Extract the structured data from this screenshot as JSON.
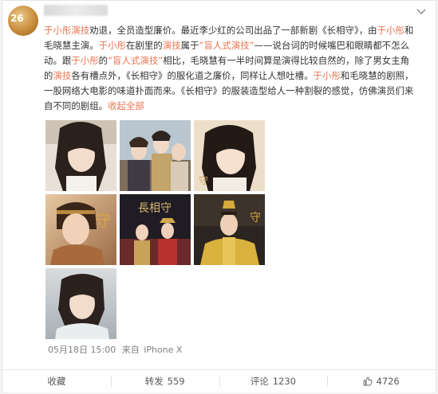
{
  "post": {
    "segments": [
      {
        "text": "于小彤演技",
        "link": true
      },
      {
        "text": "劝退，全员造型廉价。最近李少红的公司出品了一部新剧《长相守》，由",
        "link": false
      },
      {
        "text": "于小彤",
        "link": true
      },
      {
        "text": "和毛晓慧主演。",
        "link": false
      },
      {
        "text": "于小彤",
        "link": true
      },
      {
        "text": "在剧里的",
        "link": false
      },
      {
        "text": "演技",
        "link": true
      },
      {
        "text": "属于",
        "link": false
      },
      {
        "text": "“盲人式演技”",
        "link": true
      },
      {
        "text": "——说台词的时候嘴巴和眼睛都不怎么动。跟",
        "link": false
      },
      {
        "text": "于小彤",
        "link": true
      },
      {
        "text": "的",
        "link": false
      },
      {
        "text": "“盲人式演技”",
        "link": true
      },
      {
        "text": "相比，毛晓慧有一半时间算是演得比较自然的，除了男女主角的",
        "link": false
      },
      {
        "text": "演技",
        "link": true
      },
      {
        "text": "各有槽点外，《长相守》的服化道之廉价，同样让人想吐槽。",
        "link": false
      },
      {
        "text": "于小彤",
        "link": true
      },
      {
        "text": "和毛晓慧的剧照，一股网络大电影的味道扑面而来。《长相守》的服装造型给人一种割裂的感觉，仿佛演员们来自不同的剧组。",
        "link": false
      }
    ],
    "more_label": "收起全部",
    "time": "05月18日 15:00",
    "source_prefix": "来自",
    "source": "iPhone X"
  },
  "actions": {
    "favorite_label": "收藏",
    "repost_label": "转发",
    "repost_count": "559",
    "comment_label": "评论",
    "comment_count": "1230",
    "like_count": "4726"
  },
  "avatar": {
    "badge_text": "26"
  },
  "colors": {
    "link": "#eb7350",
    "meta": "#808080",
    "text": "#333333"
  }
}
